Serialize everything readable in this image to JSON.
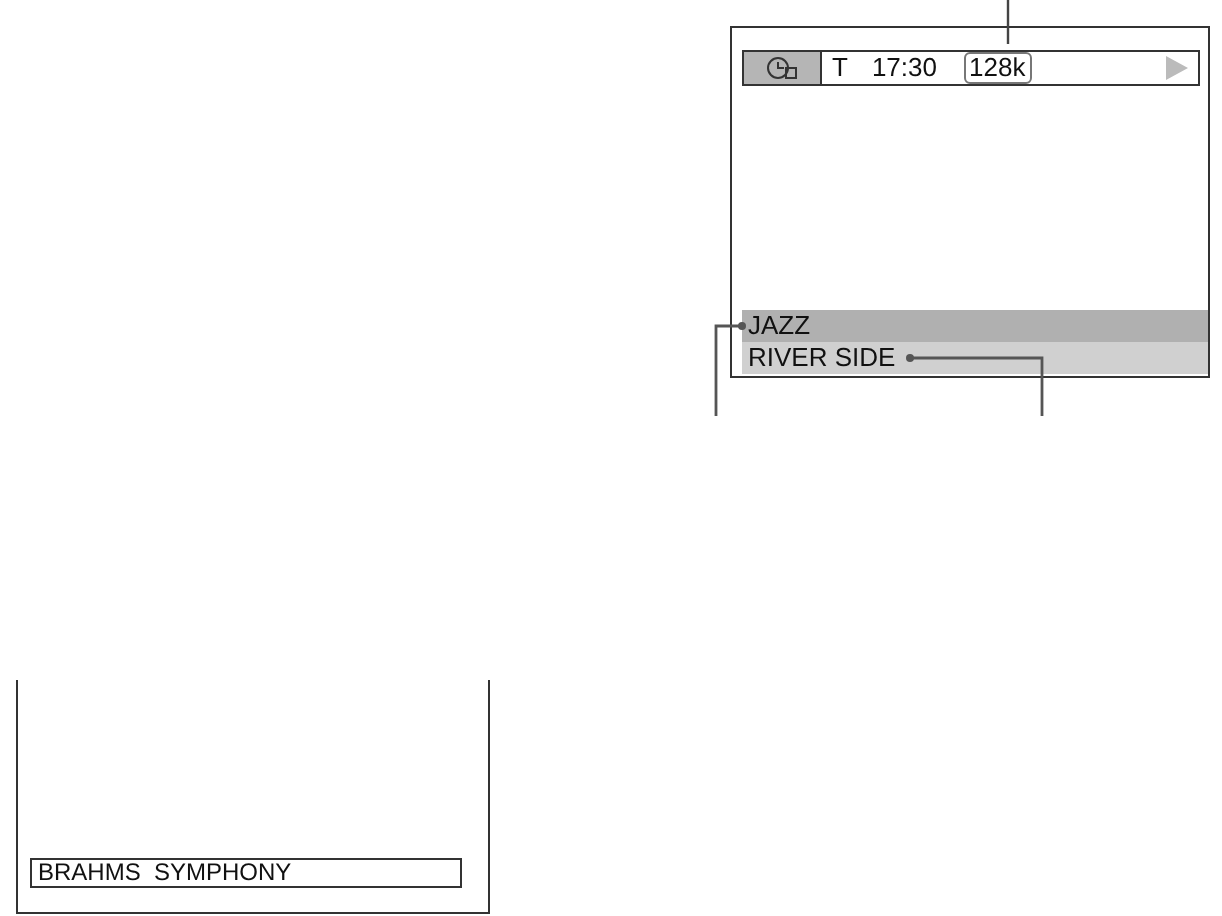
{
  "display": {
    "status_bar": {
      "mode": "T",
      "time": "17:30",
      "bitrate": "128k"
    },
    "rows": [
      {
        "text": "JAZZ",
        "selected": true
      },
      {
        "text": "RIVER SIDE",
        "selected": false
      }
    ]
  },
  "second_display": {
    "title": "BRAHMS  SYMPHONY"
  }
}
